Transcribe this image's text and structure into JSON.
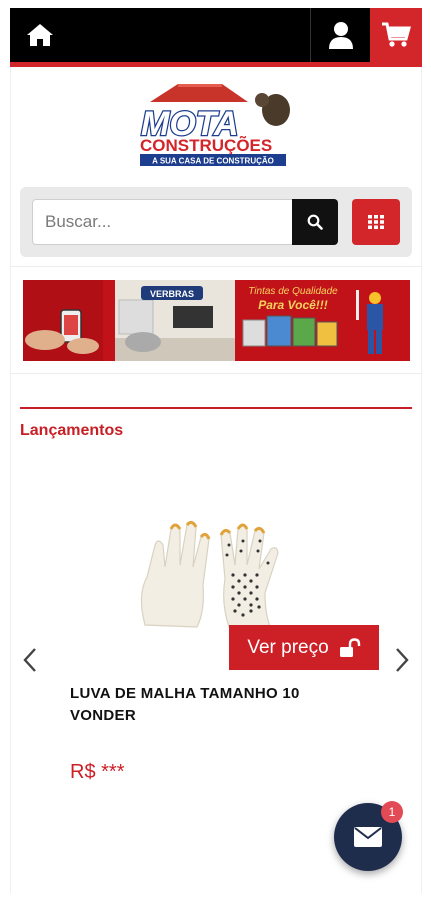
{
  "header": {
    "home_icon": "home-icon",
    "user_icon": "user-icon",
    "cart_icon": "cart-icon"
  },
  "logo": {
    "name": "MOTA",
    "subtitle": "CONSTRUÇÕES",
    "tagline": "A SUA CASA DE CONSTRUÇÃO"
  },
  "search": {
    "placeholder": "Buscar..."
  },
  "banner": {
    "brand": "VERBRAS",
    "headline_line1": "Tintas de Qualidade",
    "headline_line2": "Para Você!!!"
  },
  "section": {
    "title": "Lançamentos"
  },
  "product": {
    "name": "LUVA DE MALHA TAMANHO 10 VONDER",
    "price_button": "Ver preço",
    "price": "R$ ***"
  },
  "chat": {
    "badge_count": "1"
  },
  "colors": {
    "brand_red": "#d3262b",
    "dark_navy": "#1f2d4d",
    "black": "#000000"
  }
}
